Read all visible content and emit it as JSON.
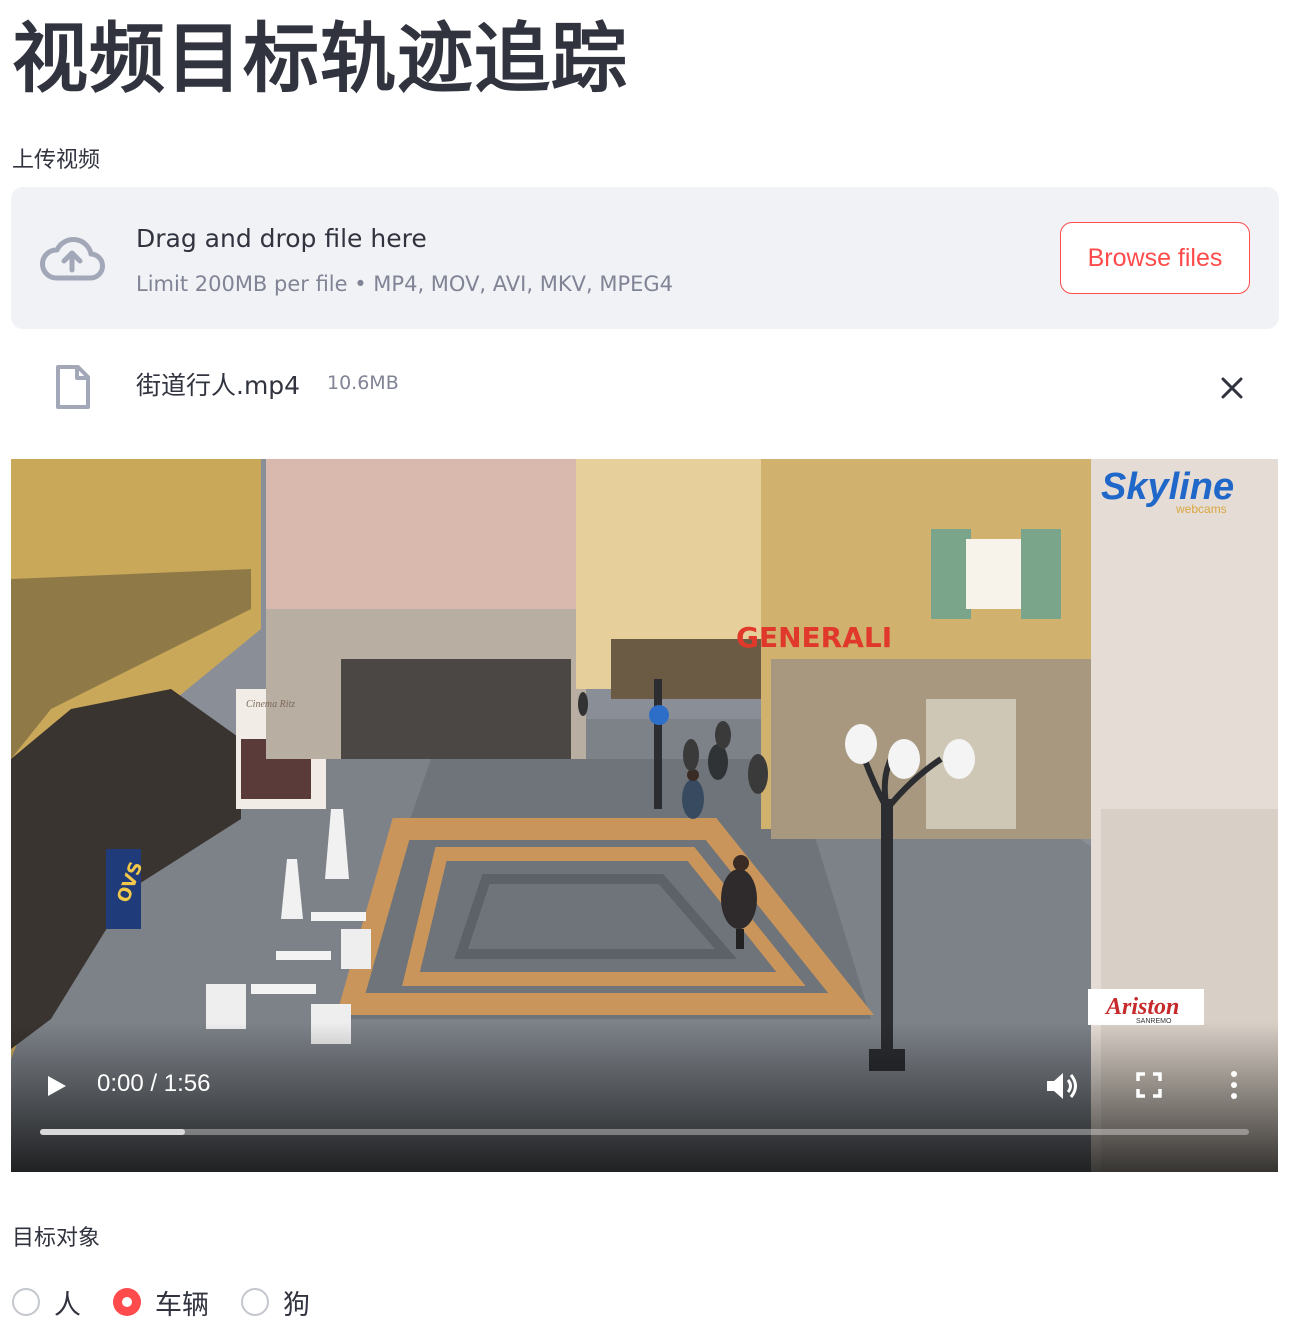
{
  "page": {
    "title": "视频目标轨迹追踪"
  },
  "uploader": {
    "label": "上传视频",
    "drop_text": "Drag and drop file here",
    "limit_text": "Limit 200MB per file • MP4, MOV, AVI, MKV, MPEG4",
    "browse_label": "Browse files",
    "icon": "cloud-upload-icon"
  },
  "file": {
    "name": "街道行人.mp4",
    "size": "10.6MB",
    "icon": "file-icon",
    "remove_icon": "close-icon"
  },
  "video": {
    "time": "0:00 / 1:56",
    "progress_fraction": 0.12,
    "overlay_logo": "Skyline",
    "overlay_logo_sub": "webcams",
    "sign_text": "GENERALI",
    "shop_sign": "Ariston",
    "shop_sign_sub": "SANREMO",
    "store_sign": "OVS",
    "cinema_sign": "Cinema Ritz",
    "controls": [
      "play-icon",
      "volume-icon",
      "fullscreen-icon",
      "more-options-icon"
    ]
  },
  "target": {
    "label": "目标对象",
    "options": [
      {
        "label": "人",
        "checked": false
      },
      {
        "label": "车辆",
        "checked": true
      },
      {
        "label": "狗",
        "checked": false
      }
    ]
  },
  "colors": {
    "accent": "#ff4b4b",
    "dropzone_bg": "#f0f2f6",
    "text": "#31333f",
    "muted": "#808495"
  }
}
